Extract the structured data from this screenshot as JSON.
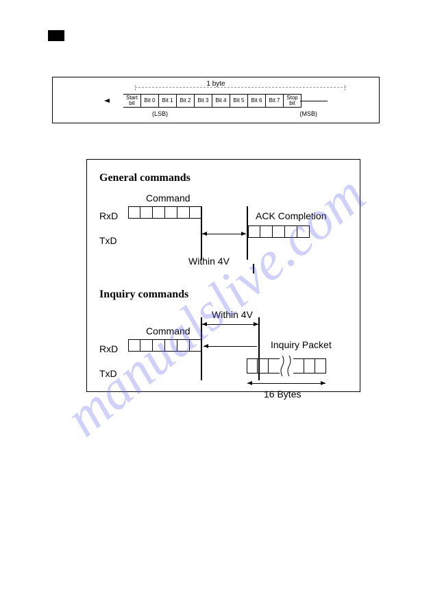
{
  "watermark": "manualslive.com",
  "figure1": {
    "byte_label": "1 byte",
    "start_bit": "Start\nbit",
    "bits": [
      "Bit 0",
      "Bit 1",
      "Bit 2",
      "Bit 3",
      "Bit 4",
      "Bit 5",
      "Bit 6",
      "Bit 7"
    ],
    "stop_bit": "Stop\nbit",
    "lsb": "(LSB)",
    "msb": "(MSB)"
  },
  "figure2": {
    "general": {
      "title": "General commands",
      "command": "Command",
      "rxd": "RxD",
      "txd": "TxD",
      "timing": "Within  4V",
      "ack": "ACK Completion"
    },
    "inquiry": {
      "title": "Inquiry commands",
      "command": "Command",
      "rxd": "RxD",
      "txd": "TxD",
      "timing": "Within  4V",
      "packet": "Inquiry  Packet",
      "bytes": "16 Bytes"
    }
  }
}
